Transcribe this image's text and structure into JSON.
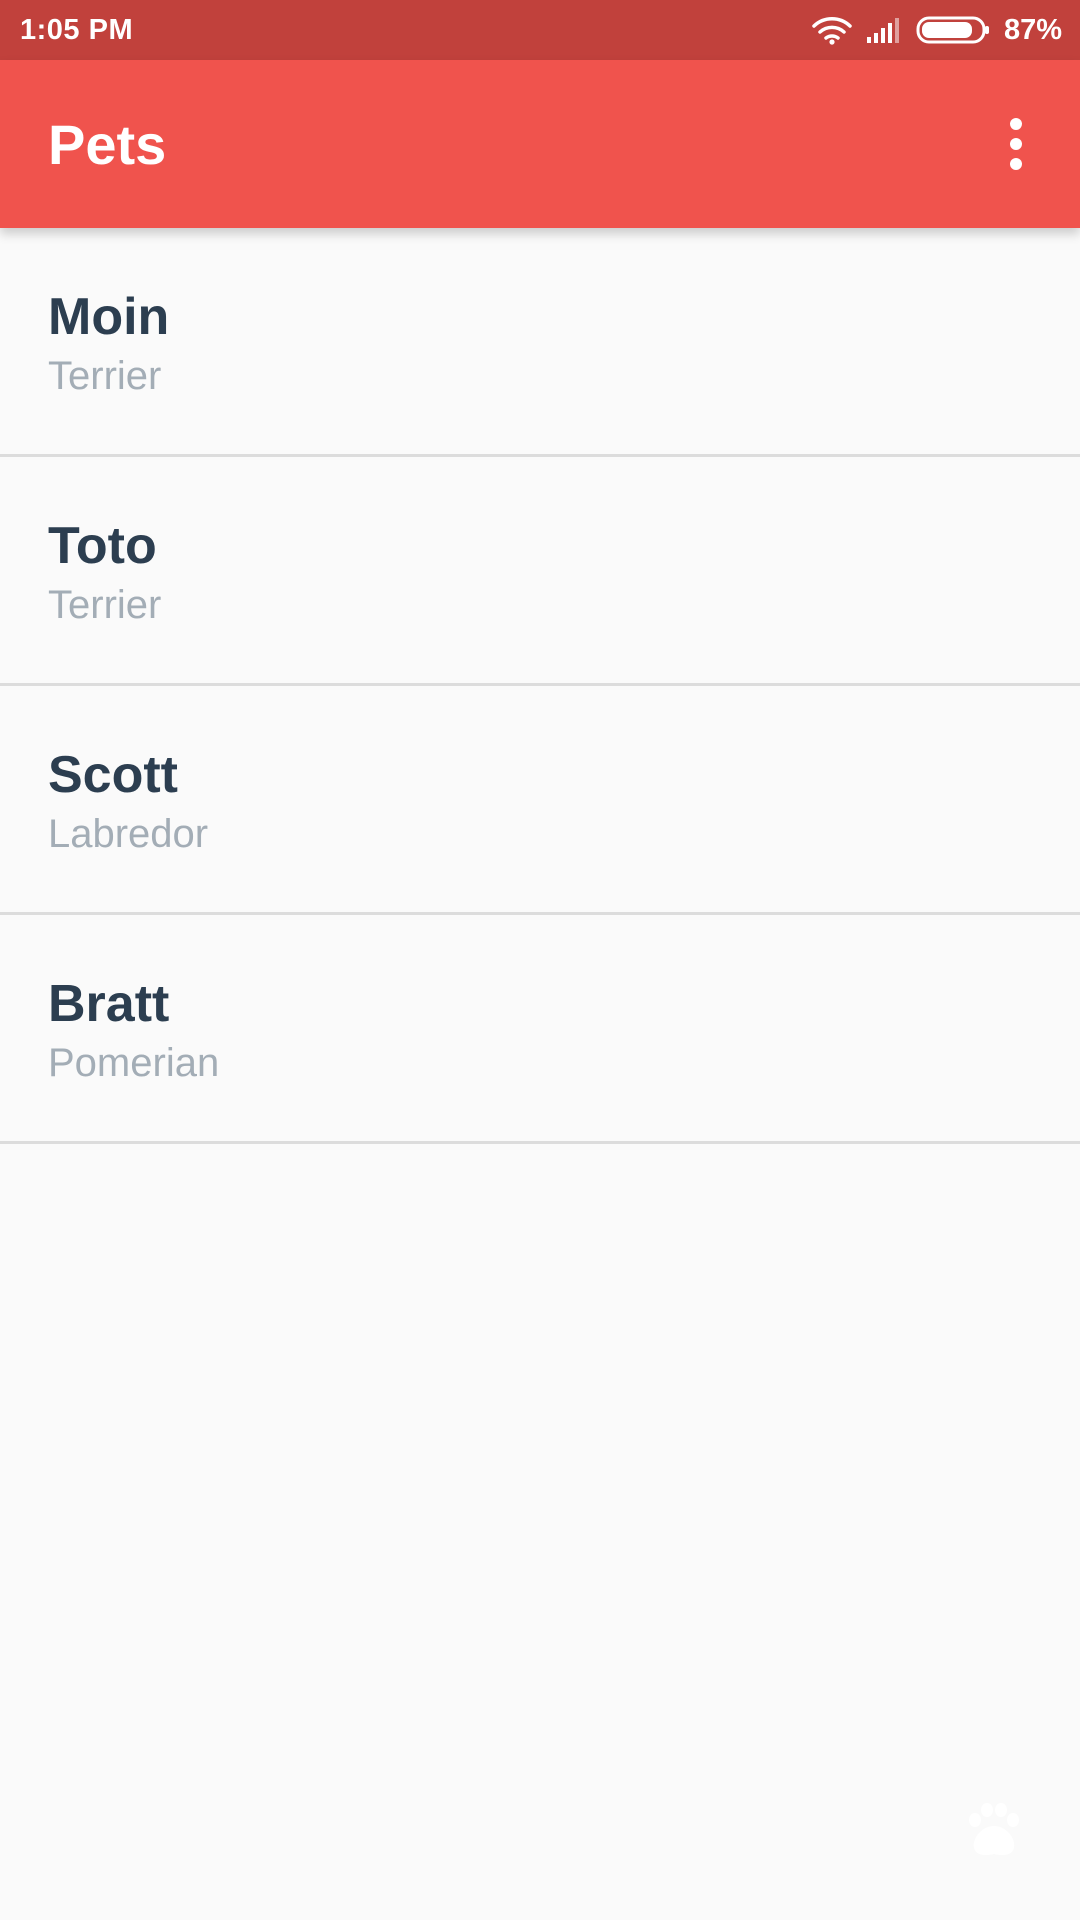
{
  "status_bar": {
    "time": "1:05 PM",
    "battery_percent": "87%",
    "battery_level": 0.87,
    "icons": [
      "wifi-icon",
      "signal-icon",
      "battery-icon"
    ]
  },
  "app_bar": {
    "title": "Pets",
    "menu_icon": "overflow-menu-icon"
  },
  "pets": [
    {
      "name": "Moin",
      "breed": "Terrier"
    },
    {
      "name": "Toto",
      "breed": "Terrier"
    },
    {
      "name": "Scott",
      "breed": "Labredor"
    },
    {
      "name": "Bratt",
      "breed": "Pomerian"
    }
  ],
  "colors": {
    "status_bar": "#c1413c",
    "app_bar": "#f0534d",
    "name_text": "#2c3e50",
    "breed_text": "#a3adb6",
    "background": "#fafafa"
  },
  "floating_icon": "paw-icon"
}
